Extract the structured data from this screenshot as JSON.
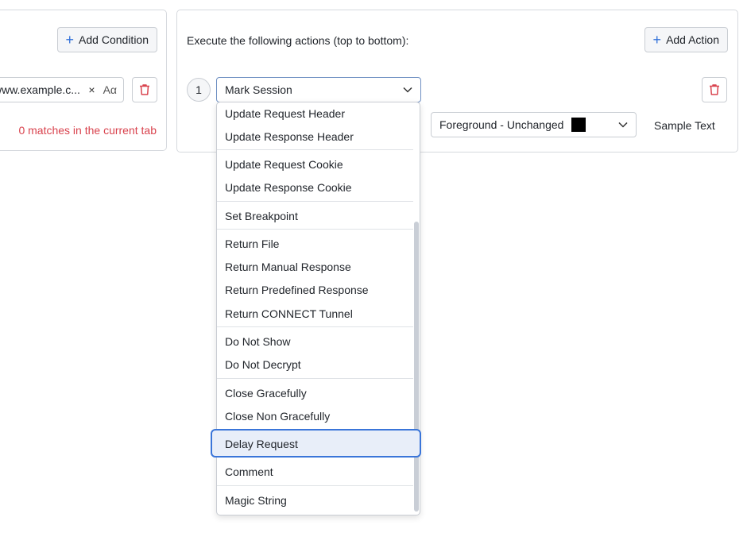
{
  "conditions": {
    "add_label": "Add Condition",
    "field_value": "www.example.c...",
    "clear_glyph": "×",
    "match_case_glyph": "Aα",
    "matches_text": "0 matches in the current tab",
    "matches_color": "#d9434e"
  },
  "actions": {
    "title": "Execute the following actions (top to bottom):",
    "add_label": "Add Action",
    "step_number": "1",
    "selected_action": "Mark Session",
    "foreground_label": "Foreground - Unchanged",
    "foreground_color": "#000000",
    "sample_text": "Sample Text"
  },
  "dropdown": {
    "options": [
      "Update Request Header",
      "Update Response Header",
      "Update Request Cookie",
      "Update Response Cookie",
      "Set Breakpoint",
      "Return File",
      "Return Manual Response",
      "Return Predefined Response",
      "Return CONNECT Tunnel",
      "Do Not Show",
      "Do Not Decrypt",
      "Close Gracefully",
      "Close Non Gracefully",
      "Delay Request",
      "Comment",
      "Magic String"
    ],
    "highlighted": "Delay Request"
  },
  "icons": {
    "plus": "plus-icon",
    "trash": "trash-icon",
    "chevron": "chevron-down-icon",
    "accent_color": "#2f6fd8",
    "danger_color": "#d9434e"
  }
}
